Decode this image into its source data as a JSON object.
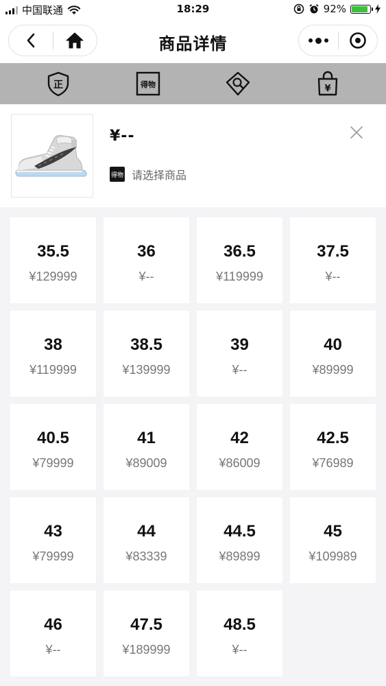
{
  "status_bar": {
    "carrier": "中国联通",
    "time": "18:29",
    "battery": "92%",
    "battery_level": 0.92,
    "icons": [
      "signal-icon",
      "wifi-icon",
      "orientation-lock-icon",
      "alarm-icon",
      "battery-icon",
      "charging-icon"
    ]
  },
  "nav": {
    "title": "商品详情",
    "icons": [
      "back-icon",
      "home-icon",
      "more-icon",
      "capsule-close-icon"
    ]
  },
  "feature_strip": {
    "items": [
      {
        "name": "authentic-icon",
        "glyph": "正"
      },
      {
        "name": "dewu-logo-icon",
        "glyph": "得物"
      },
      {
        "name": "identify-icon",
        "glyph": ""
      },
      {
        "name": "price-bag-icon",
        "glyph": "¥"
      }
    ]
  },
  "product": {
    "price": "¥--",
    "brand_badge": "得物",
    "hint": "请选择商品",
    "image": "sneaker-image"
  },
  "sizes": [
    {
      "size": "35.5",
      "price": "¥129999"
    },
    {
      "size": "36",
      "price": "¥--"
    },
    {
      "size": "36.5",
      "price": "¥119999"
    },
    {
      "size": "37.5",
      "price": "¥--"
    },
    {
      "size": "38",
      "price": "¥119999"
    },
    {
      "size": "38.5",
      "price": "¥139999"
    },
    {
      "size": "39",
      "price": "¥--"
    },
    {
      "size": "40",
      "price": "¥89999"
    },
    {
      "size": "40.5",
      "price": "¥79999"
    },
    {
      "size": "41",
      "price": "¥89009"
    },
    {
      "size": "42",
      "price": "¥86009"
    },
    {
      "size": "42.5",
      "price": "¥76989"
    },
    {
      "size": "43",
      "price": "¥79999"
    },
    {
      "size": "44",
      "price": "¥83339"
    },
    {
      "size": "44.5",
      "price": "¥89899"
    },
    {
      "size": "45",
      "price": "¥109989"
    },
    {
      "size": "46",
      "price": "¥--"
    },
    {
      "size": "47.5",
      "price": "¥189999"
    },
    {
      "size": "48.5",
      "price": "¥--"
    }
  ],
  "colors": {
    "strip_bg": "#b3b3b3",
    "page_bg": "#f4f4f6",
    "battery_fill": "#3cc13b",
    "price_gray": "#777777"
  }
}
